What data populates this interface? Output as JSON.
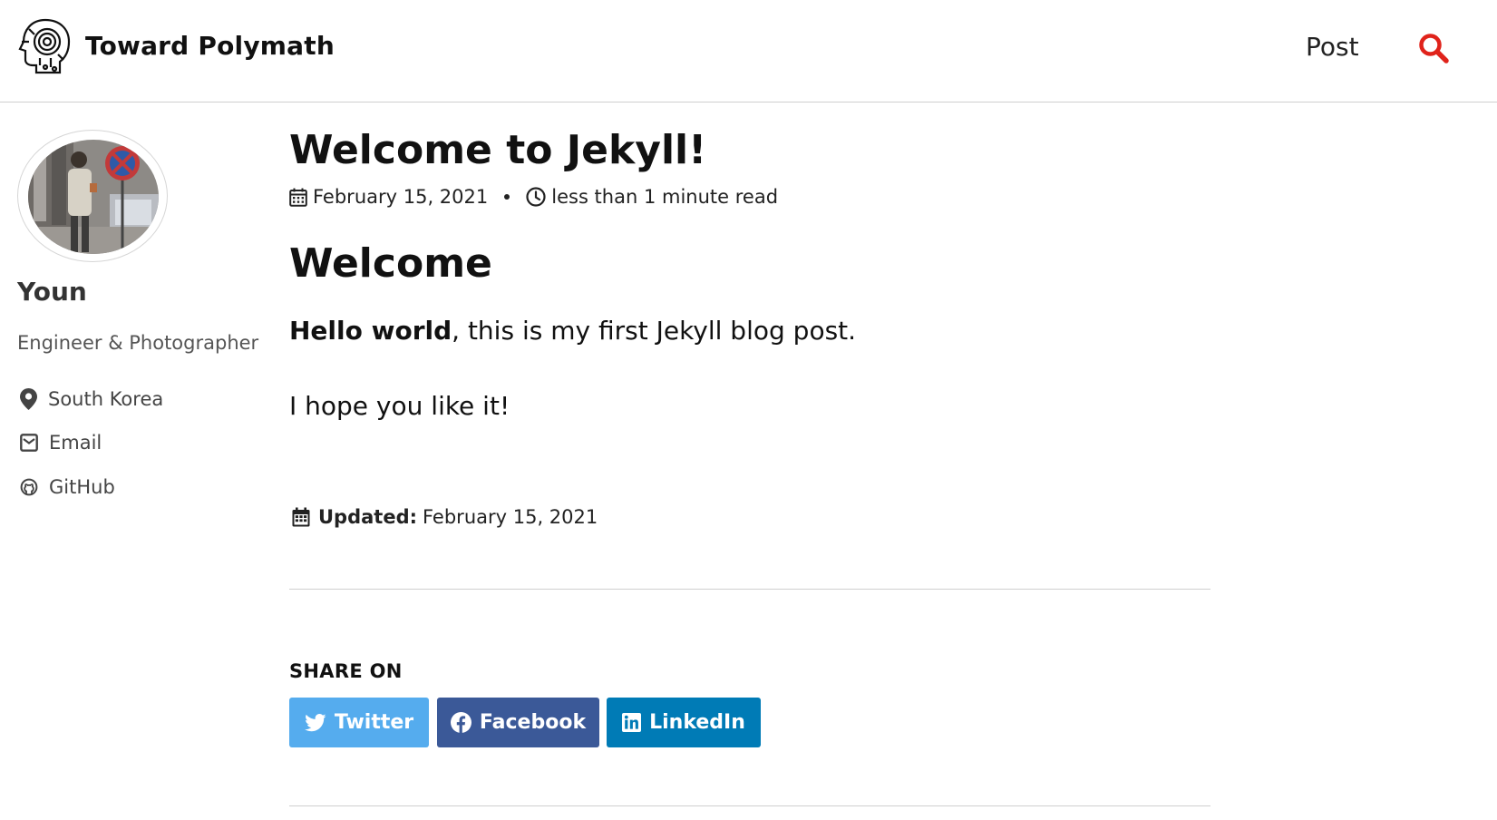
{
  "header": {
    "site_title": "Toward Polymath",
    "nav": [
      {
        "label": "Post"
      }
    ],
    "logo_icon": "robot-head-icon",
    "search_icon": "search-icon",
    "search_color": "#e0231b"
  },
  "sidebar": {
    "author_name": "Youn",
    "bio": "Engineer & Photographer",
    "links": [
      {
        "label": "South Korea",
        "icon": "map-marker-icon"
      },
      {
        "label": "Email",
        "icon": "envelope-icon"
      },
      {
        "label": "GitHub",
        "icon": "github-icon"
      }
    ]
  },
  "article": {
    "title": "Welcome to Jekyll!",
    "date": "February 15, 2021",
    "read_time": "less than 1 minute read",
    "heading": "Welcome",
    "para1_bold": "Hello world",
    "para1_rest": ", this is my first Jekyll blog post.",
    "para2": "I hope you like it!",
    "updated_label": "Updated:",
    "updated_date": "February 15, 2021"
  },
  "share": {
    "title": "SHARE ON",
    "buttons": [
      {
        "label": "Twitter",
        "icon": "twitter-icon",
        "color": "#55acee"
      },
      {
        "label": "Facebook",
        "icon": "facebook-icon",
        "color": "#3b5998"
      },
      {
        "label": "LinkedIn",
        "icon": "linkedin-icon",
        "color": "#007bb6"
      }
    ]
  }
}
